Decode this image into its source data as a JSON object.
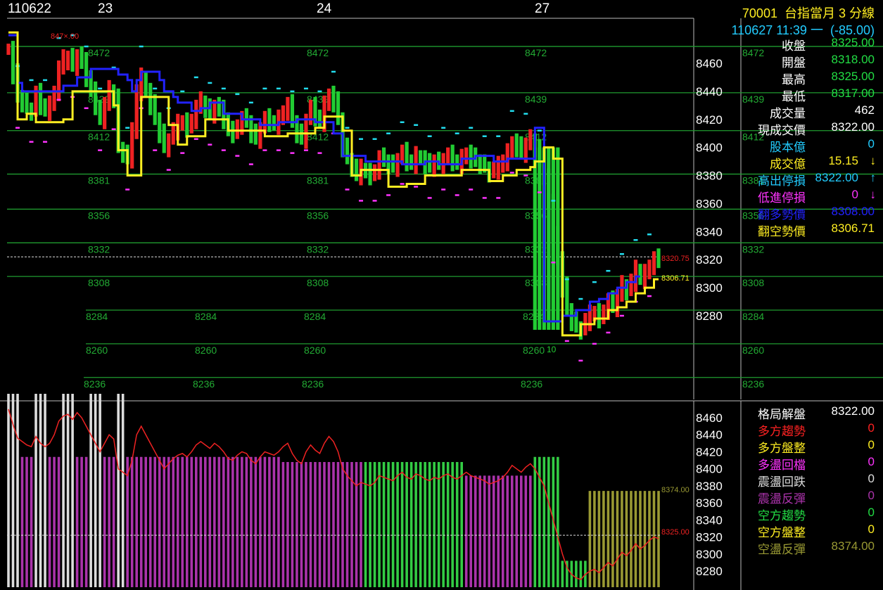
{
  "header": {
    "dates": [
      "110622",
      "23",
      "24",
      "27"
    ],
    "code": "70001",
    "title": "台指當月 3 分線",
    "timestamp": "110627 11:39 一",
    "change": "(-85.00)"
  },
  "info_panel": [
    {
      "label": "收盤",
      "value": "8325.00",
      "label_color": "#ffffff",
      "value_color": "#22dd44"
    },
    {
      "label": "開盤",
      "value": "8318.00",
      "label_color": "#ffffff",
      "value_color": "#22dd44"
    },
    {
      "label": "最高",
      "value": "8325.00",
      "label_color": "#ffffff",
      "value_color": "#22dd44"
    },
    {
      "label": "最低",
      "value": "8317.00",
      "label_color": "#ffffff",
      "value_color": "#22dd44"
    },
    {
      "label": "成交量",
      "value": "462",
      "label_color": "#ffffff",
      "value_color": "#ffffff"
    },
    {
      "label": "現成交價",
      "value": "8322.00",
      "label_color": "#ffffff",
      "value_color": "#ffffff"
    },
    {
      "label": "股本億",
      "value": "0",
      "label_color": "#22ccff",
      "value_color": "#22ccff"
    },
    {
      "label": "成交億",
      "value": "15.15",
      "arrow": "↓",
      "label_color": "#ffee22",
      "value_color": "#ffee22"
    },
    {
      "label": "高出停損",
      "value": "8322.00",
      "arrow": "↑",
      "label_color": "#22ccff",
      "value_color": "#22ccff"
    },
    {
      "label": "低進停損",
      "value": "0",
      "arrow": "↓",
      "label_color": "#ff33ff",
      "value_color": "#ff33ff"
    },
    {
      "label": "翻多勢價",
      "value": "8308.00",
      "label_color": "#2222ff",
      "value_color": "#2222ff"
    },
    {
      "label": "翻空勢價",
      "value": "8306.71",
      "label_color": "#ffee22",
      "value_color": "#ffee22"
    }
  ],
  "pattern_panel": [
    {
      "label": "格局解盤",
      "value": "8322.00",
      "label_color": "#ffffff",
      "value_color": "#ffffff"
    },
    {
      "label": "多方趨勢",
      "value": "0",
      "label_color": "#ff2222",
      "value_color": "#ff2222"
    },
    {
      "label": "多方盤整",
      "value": "0",
      "label_color": "#ffee22",
      "value_color": "#ffee22"
    },
    {
      "label": "多盪回檔",
      "value": "0",
      "label_color": "#ff33ff",
      "value_color": "#ff33ff"
    },
    {
      "label": "震盪回跌",
      "value": "0",
      "label_color": "#dddddd",
      "value_color": "#dddddd"
    },
    {
      "label": "震盪反彈",
      "value": "0",
      "label_color": "#aa33aa",
      "value_color": "#aa33aa"
    },
    {
      "label": "空方趨勢",
      "value": "0",
      "label_color": "#22dd44",
      "value_color": "#22dd44"
    },
    {
      "label": "空方盤整",
      "value": "0",
      "label_color": "#ffee22",
      "value_color": "#ffee22"
    },
    {
      "label": "空盪反彈",
      "value": "8374.00",
      "label_color": "#999933",
      "value_color": "#999933"
    }
  ],
  "chart_data": [
    {
      "type": "candlestick",
      "title": "台指當月 3 分線",
      "y_ticks": [
        8460,
        8440,
        8420,
        8400,
        8380,
        8360,
        8340,
        8320,
        8300,
        8280
      ],
      "ylim": [
        8226,
        8492
      ],
      "grid_levels": [
        8472,
        8439,
        8412,
        8381,
        8356,
        8332,
        8308,
        8284,
        8260,
        8236
      ],
      "grid_level_labels": [
        "8472",
        "8439",
        "8412",
        "8381",
        "8356",
        "8332",
        "8308",
        "8284",
        "8260",
        "8236"
      ],
      "markers": {
        "high_marker": "847×.00",
        "last_price": "8320.75",
        "turn_short": "8306.71",
        "low_marker": "8260",
        "low_suffix": "10"
      },
      "series": [
        {
          "name": "翻多勢價",
          "color": "#2222ff",
          "values": [
            8480,
            8480,
            8446,
            8440,
            8440,
            8440,
            8440,
            8440,
            8440,
            8440,
            8440,
            8440,
            8444,
            8444,
            8444,
            8450,
            8450,
            8450,
            8456,
            8456,
            8456,
            8456,
            8456,
            8456,
            8452,
            8452,
            8448,
            8440,
            8448,
            8454,
            8454,
            8454,
            8454,
            8448,
            8440,
            8440,
            8436,
            8432,
            8432,
            8432,
            8426,
            8426,
            8428,
            8428,
            8432,
            8432,
            8432,
            8424,
            8424,
            8424,
            8424,
            8420,
            8420,
            8420,
            8420,
            8416,
            8416,
            8416,
            8416,
            8418,
            8418,
            8418,
            8418,
            8420,
            8420,
            8420,
            8420,
            8418,
            8418,
            8418,
            8418,
            8410,
            8410,
            8394,
            8394,
            8394,
            8394,
            8394,
            8390,
            8390,
            8390,
            8390,
            8390,
            8390,
            8390,
            8390,
            8388,
            8388,
            8388,
            8388,
            8388,
            8390,
            8390,
            8390,
            8388,
            8388,
            8388,
            8388,
            8388,
            8392,
            8392,
            8392,
            8394,
            8394,
            8394,
            8394,
            8390,
            8390,
            8390,
            8392,
            8392,
            8392,
            8392,
            8392,
            8392,
            8414,
            8414,
            8276,
            8276,
            8276,
            8276,
            8280,
            8280,
            8280,
            8284,
            8284,
            8284,
            8290,
            8290,
            8292,
            8292,
            8296,
            8296,
            8300,
            8300,
            8304,
            8304,
            8308,
            8308
          ]
        },
        {
          "name": "翻空勢價",
          "color": "#ffee22",
          "values": [
            8482,
            8482,
            8420,
            8420,
            8424,
            8424,
            8418,
            8418,
            8418,
            8418,
            8418,
            8418,
            8420,
            8420,
            8440,
            8440,
            8440,
            8440,
            8440,
            8440,
            8440,
            8440,
            8440,
            8430,
            8398,
            8398,
            8380,
            8380,
            8380,
            8436,
            8436,
            8436,
            8436,
            8436,
            8436,
            8416,
            8416,
            8402,
            8402,
            8408,
            8408,
            8408,
            8408,
            8420,
            8420,
            8420,
            8420,
            8420,
            8412,
            8412,
            8412,
            8412,
            8412,
            8412,
            8412,
            8412,
            8408,
            8408,
            8408,
            8408,
            8408,
            8410,
            8410,
            8410,
            8410,
            8410,
            8410,
            8414,
            8414,
            8422,
            8422,
            8422,
            8422,
            8412,
            8412,
            8380,
            8380,
            8384,
            8384,
            8384,
            8384,
            8384,
            8384,
            8372,
            8372,
            8372,
            8372,
            8374,
            8374,
            8374,
            8374,
            8380,
            8380,
            8380,
            8380,
            8380,
            8380,
            8380,
            8380,
            8384,
            8384,
            8384,
            8384,
            8384,
            8384,
            8376,
            8376,
            8376,
            8380,
            8380,
            8380,
            8384,
            8384,
            8384,
            8386,
            8390,
            8390,
            8400,
            8400,
            8392,
            8392,
            8266,
            8266,
            8266,
            8266,
            8274,
            8274,
            8274,
            8278,
            8278,
            8278,
            8284,
            8284,
            8286,
            8286,
            8290,
            8290,
            8296,
            8296,
            8300,
            8300,
            8306,
            8306
          ]
        },
        {
          "name": "close",
          "color": "#ffffff",
          "values": [
            8470,
            8452,
            8436,
            8432,
            8428,
            8426,
            8438,
            8430,
            8426,
            8430,
            8440,
            8456,
            8462,
            8464,
            8458,
            8466,
            8460,
            8450,
            8440,
            8430,
            8420,
            8430,
            8440,
            8435,
            8400,
            8396,
            8392,
            8410,
            8440,
            8450,
            8440,
            8430,
            8420,
            8410,
            8400,
            8406,
            8412,
            8416,
            8418,
            8414,
            8420,
            8428,
            8432,
            8428,
            8424,
            8430,
            8426,
            8420,
            8412,
            8410,
            8416,
            8420,
            8418,
            8410,
            8406,
            8414,
            8420,
            8418,
            8416,
            8420,
            8426,
            8430,
            8418,
            8410,
            8406,
            8420,
            8428,
            8422,
            8418,
            8430,
            8438,
            8432,
            8420,
            8400,
            8392,
            8386,
            8380,
            8384,
            8382,
            8380,
            8384,
            8392,
            8390,
            8388,
            8386,
            8392,
            8396,
            8390,
            8388,
            8394,
            8392,
            8388,
            8386,
            8390,
            8388,
            8392,
            8394,
            8390,
            8388,
            8392,
            8396,
            8392,
            8390,
            8388,
            8386,
            8382,
            8384,
            8386,
            8390,
            8396,
            8404,
            8400,
            8396,
            8402,
            8406,
            8400,
            8390,
            8380,
            8360,
            8340,
            8320,
            8300,
            8284,
            8276,
            8272,
            8270,
            8276,
            8280,
            8282,
            8278,
            8284,
            8290,
            8286,
            8294,
            8302,
            8298,
            8304,
            8312,
            8306,
            8310,
            8316,
            8320,
            8318
          ]
        }
      ]
    },
    {
      "type": "bar",
      "y_ticks": [
        8460,
        8440,
        8420,
        8400,
        8380,
        8360,
        8340,
        8320,
        8300,
        8280
      ],
      "markers": {
        "upper": "8374.00",
        "current": "8325.00"
      }
    }
  ]
}
